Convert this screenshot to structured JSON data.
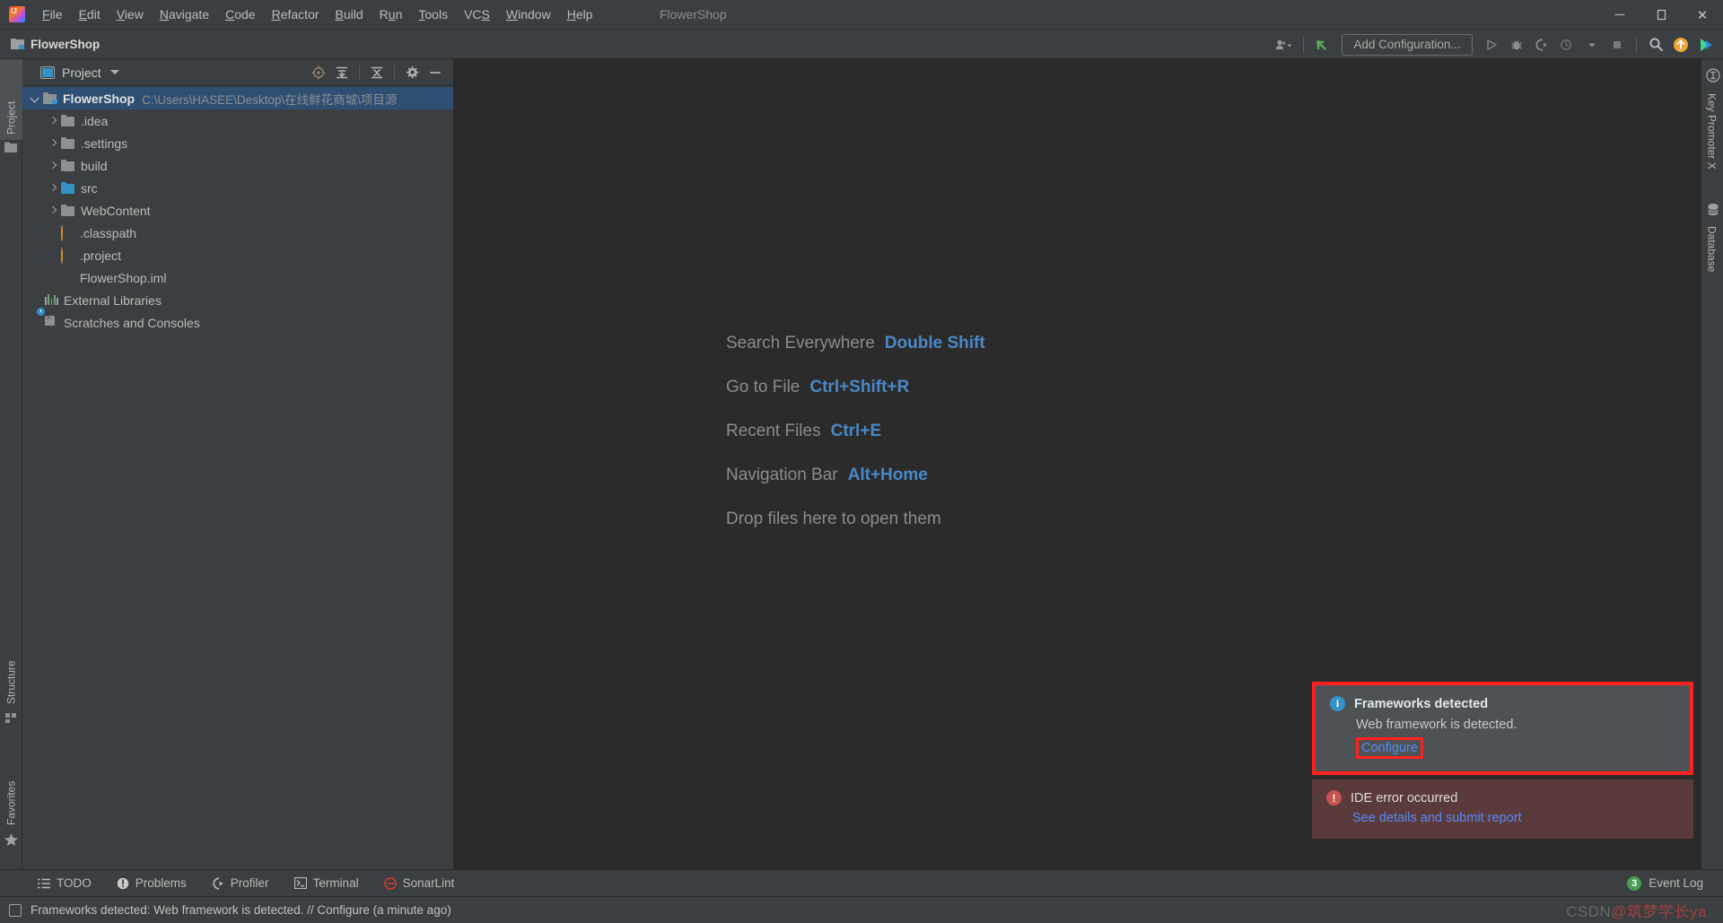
{
  "window": {
    "title": "FlowerShop",
    "controls": {
      "minimize": "─",
      "maximize": "❐",
      "close": "✕"
    }
  },
  "menubar": {
    "logo_icon": "intellij-idea-logo",
    "items": [
      {
        "label": "File"
      },
      {
        "label": "Edit"
      },
      {
        "label": "View"
      },
      {
        "label": "Navigate"
      },
      {
        "label": "Code"
      },
      {
        "label": "Refactor"
      },
      {
        "label": "Build"
      },
      {
        "label": "Run"
      },
      {
        "label": "Tools"
      },
      {
        "label": "VCS"
      },
      {
        "label": "Window"
      },
      {
        "label": "Help"
      }
    ]
  },
  "navbar": {
    "project_name": "FlowerShop",
    "project_icon": "module-folder-icon"
  },
  "run_toolbar": {
    "user_icon": "user-chevron-icon",
    "update_icon": "update-project-arrow-icon",
    "add_configuration_label": "Add Configuration...",
    "run_icon": "run-play-icon",
    "debug_icon": "debug-bug-icon",
    "run_with_coverage_icon": "run-coverage-icon",
    "profile_icon": "profiler-icon",
    "stop_icon": "stop-square-icon",
    "search_icon": "search-icon",
    "updates_icon": "update-available-icon",
    "plugin_icon": "plugin-colorful-icon"
  },
  "left_toolwindows": [
    {
      "label": "Project",
      "icon": "project-folder-icon",
      "selected": true
    },
    {
      "label": "Structure",
      "icon": "structure-icon",
      "selected": false
    },
    {
      "label": "Favorites",
      "icon": "favorites-star-icon",
      "selected": false
    }
  ],
  "right_toolwindows": [
    {
      "label": "Key Promoter X",
      "icon": "key-promoter-icon"
    },
    {
      "label": "Database",
      "icon": "database-icon"
    }
  ],
  "project_panel": {
    "title": "Project",
    "view_icon": "project-view-icon",
    "dropdown_icon": "chevron-down-icon",
    "tools": [
      {
        "name": "scroll-from-source-icon",
        "glyph": "⊕"
      },
      {
        "name": "expand-all-icon",
        "glyph": "⤓"
      },
      {
        "name": "collapse-all-icon",
        "glyph": "⤒"
      },
      {
        "name": "settings-gear-icon",
        "glyph": "⚙"
      },
      {
        "name": "hide-panel-icon",
        "glyph": "—"
      }
    ],
    "tree": [
      {
        "label": "FlowerShop",
        "path": "C:\\Users\\HASEE\\Desktop\\在线鲜花商城\\项目源",
        "icon": "module-folder-icon",
        "arrow": "down",
        "indent": 0,
        "bold": true,
        "selected": true
      },
      {
        "label": ".idea",
        "icon": "folder-icon",
        "arrow": "right",
        "indent": 1,
        "bold": false,
        "selected": false
      },
      {
        "label": ".settings",
        "icon": "folder-icon",
        "arrow": "right",
        "indent": 1,
        "bold": false,
        "selected": false
      },
      {
        "label": "build",
        "icon": "folder-icon",
        "arrow": "right",
        "indent": 1,
        "bold": false,
        "selected": false
      },
      {
        "label": "src",
        "icon": "source-folder-icon",
        "arrow": "right",
        "indent": 1,
        "bold": false,
        "selected": false
      },
      {
        "label": "WebContent",
        "icon": "folder-icon",
        "arrow": "right",
        "indent": 1,
        "bold": false,
        "selected": false
      },
      {
        "label": ".classpath",
        "icon": "xml-file-icon",
        "arrow": "none",
        "indent": 1,
        "bold": false,
        "selected": false
      },
      {
        "label": ".project",
        "icon": "xml-file-icon",
        "arrow": "none",
        "indent": 1,
        "bold": false,
        "selected": false
      },
      {
        "label": "FlowerShop.iml",
        "icon": "iml-file-icon",
        "arrow": "none",
        "indent": 1,
        "bold": false,
        "selected": false
      },
      {
        "label": "External Libraries",
        "icon": "external-libraries-icon",
        "arrow": "none",
        "indent": 0,
        "bold": false,
        "selected": false
      },
      {
        "label": "Scratches and Consoles",
        "icon": "scratches-icon",
        "arrow": "none",
        "indent": 0,
        "bold": false,
        "selected": false
      }
    ]
  },
  "editor_tips": [
    {
      "label": "Search Everywhere",
      "key": "Double Shift"
    },
    {
      "label": "Go to File",
      "key": "Ctrl+Shift+R"
    },
    {
      "label": "Recent Files",
      "key": "Ctrl+E"
    },
    {
      "label": "Navigation Bar",
      "key": "Alt+Home"
    },
    {
      "label": "Drop files here to open them",
      "key": ""
    }
  ],
  "notifications": [
    {
      "icon": "info-icon",
      "icon_glyph": "i",
      "title": "Frameworks detected",
      "body": "Web framework is detected.",
      "link": "Configure",
      "highlighted": true,
      "link_highlighted": true,
      "type": "info"
    },
    {
      "icon": "error-icon",
      "icon_glyph": "!",
      "title": "IDE error occurred",
      "body": "",
      "link": "See details and submit report",
      "highlighted": false,
      "link_highlighted": false,
      "type": "error"
    }
  ],
  "bottom_toolwindows": [
    {
      "label": "TODO",
      "icon": "todo-list-icon",
      "glyph": "☰"
    },
    {
      "label": "Problems",
      "icon": "problems-icon",
      "glyph": "❗"
    },
    {
      "label": "Profiler",
      "icon": "profiler-icon",
      "glyph": "◔"
    },
    {
      "label": "Terminal",
      "icon": "terminal-icon",
      "glyph": "≥"
    },
    {
      "label": "SonarLint",
      "icon": "sonarlint-icon",
      "glyph": "⊖"
    }
  ],
  "event_log": {
    "label": "Event Log",
    "count": "3",
    "icon": "event-log-badge"
  },
  "status_bar": {
    "icon": "status-message-icon",
    "message": "Frameworks detected: Web framework is detected. // Configure (a minute ago)"
  },
  "watermark": {
    "prefix": "CSDN",
    "text": "@筑梦学长ya"
  },
  "colors": {
    "accent_blue": "#4a88c7",
    "link_blue": "#548af7",
    "highlight_red": "#ff2020",
    "selection_blue": "#2f4f72",
    "error_bg": "#5b3a3c",
    "panel_bg": "#3c3f41",
    "editor_bg": "#2b2b2b"
  }
}
